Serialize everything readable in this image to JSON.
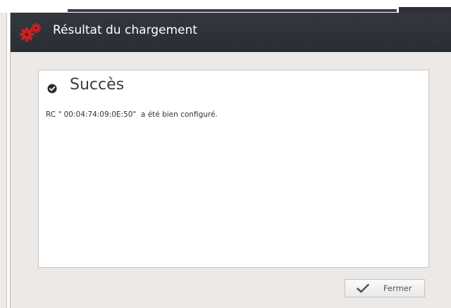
{
  "dialog": {
    "title": "Résultat du chargement",
    "title_icon": "gears-icon",
    "accent_color": "#d11f1f",
    "titlebar_color": "#2f3239"
  },
  "result": {
    "status_icon": "check-circle-icon",
    "heading": "Succès",
    "message": "RC \" 00:04:74:09:0E:50\"  a été bien configuré."
  },
  "actions": {
    "close_icon": "checkmark-icon",
    "close_label": "Fermer"
  }
}
